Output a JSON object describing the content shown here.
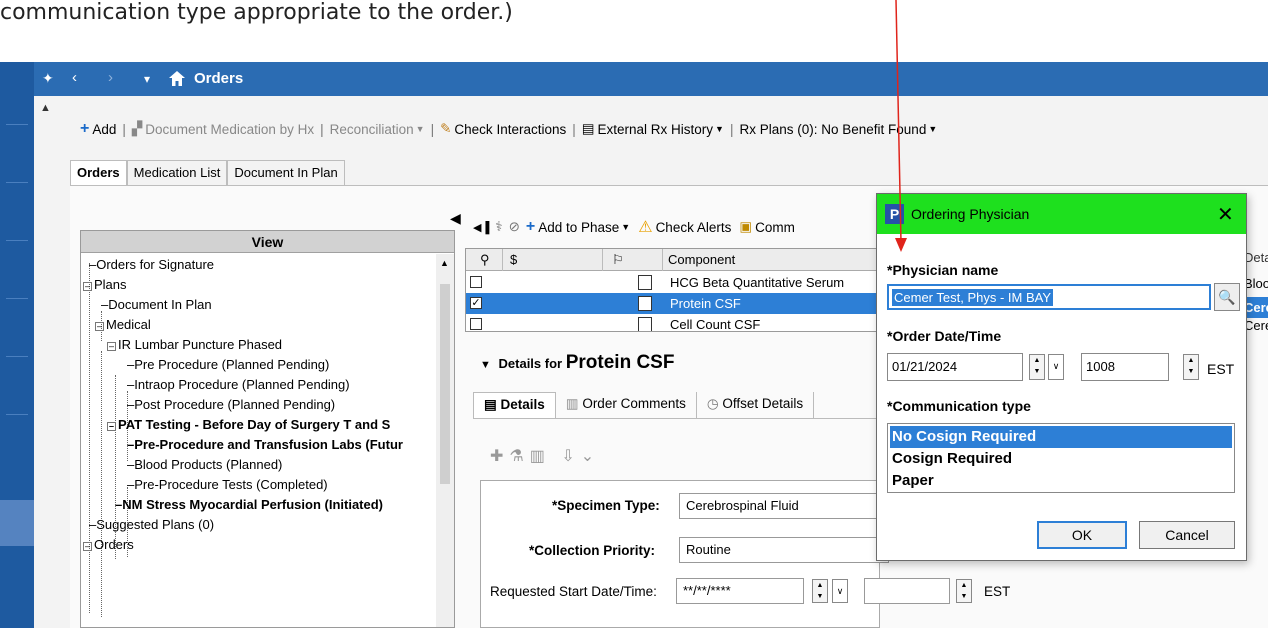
{
  "caption": "communication type appropriate to the order.)",
  "topbar": {
    "pin_icon": "pin-icon",
    "back_glyph": "‹",
    "forward_glyph": "›",
    "menu_glyph": "▾",
    "home_icon": "home-icon",
    "title": "Orders"
  },
  "toolbar": {
    "add": "Add",
    "document_medication": "Document Medication by Hx",
    "reconciliation": "Reconciliation",
    "check_interactions": "Check Interactions",
    "external_rx_history": "External Rx History",
    "rx_plans": "Rx Plans (0): No Benefit Found"
  },
  "tabs": [
    "Orders",
    "Medication List",
    "Document In Plan"
  ],
  "view": {
    "header": "View",
    "items": [
      "Orders for Signature",
      "Plans",
      "Document In Plan",
      "Medical",
      "IR Lumbar Puncture Phased",
      "Pre Procedure (Planned Pending)",
      "Intraop Procedure (Planned Pending)",
      "Post Procedure (Planned Pending)",
      "PAT Testing - Before Day of Surgery T and S",
      "Pre-Procedure and Transfusion Labs (Futur",
      "Blood Products (Planned)",
      "Pre-Procedure Tests (Completed)",
      "NM Stress Myocardial Perfusion (Initiated)",
      "Suggested Plans (0)",
      "Orders"
    ]
  },
  "midtoolbar": {
    "add_to_phase": "Add to Phase",
    "check_alerts": "Check Alerts",
    "comm": "Comm"
  },
  "grid": {
    "header_dollar": "$",
    "header_component": "Component",
    "rows": [
      {
        "name": "HCG Beta Quantitative Serum",
        "checked": false
      },
      {
        "name": "Protein CSF",
        "checked": true
      },
      {
        "name": "Cell Count CSF",
        "checked": false
      }
    ]
  },
  "details": {
    "prefix": "Details for",
    "order": "Protein CSF",
    "tabs": [
      "Details",
      "Order Comments",
      "Offset Details"
    ],
    "specimen_label": "*Specimen Type:",
    "specimen_value": "Cerebrospinal Fluid",
    "priority_label": "*Collection Priority:",
    "priority_value": "Routine",
    "start_label": "Requested Start Date/Time:",
    "start_value": "**/**/****",
    "start_tz": "EST"
  },
  "dialog": {
    "title": "Ordering Physician",
    "logo_letter": "P",
    "close": "✕",
    "physician_label": "*Physician name",
    "physician_value": "Cemer Test, Phys - IM BAY",
    "order_dt_label": "*Order Date/Time",
    "date_value": "01/21/2024",
    "time_value": "1008",
    "tz": "EST",
    "comm_label": "*Communication type",
    "comm_options": [
      "No Cosign Required",
      "Cosign Required",
      "Paper"
    ],
    "comm_selected": "No Cosign Required",
    "ok": "OK",
    "cancel": "Cancel"
  },
  "partial_right": {
    "header": "Deta",
    "row1": "Bloo",
    "row2": "Cere",
    "row3": "Cere"
  },
  "colors": {
    "topbar": "#2b6cb3",
    "dialog_title": "#1ee01e",
    "selection": "#2d7fd6",
    "arrow": "#e0241b"
  }
}
